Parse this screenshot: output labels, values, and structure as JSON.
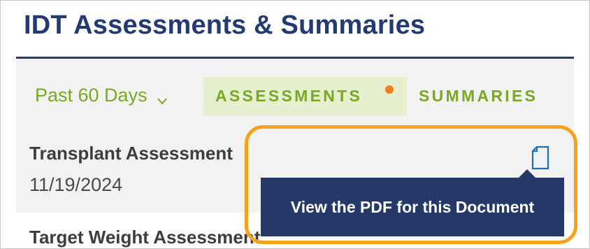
{
  "header": {
    "title": "IDT Assessments & Summaries"
  },
  "filters": {
    "range_label": "Past 60 Days",
    "range_icon": "chevron-down-icon"
  },
  "tabs": [
    {
      "label": "ASSESSMENTS",
      "selected": true,
      "has_notification": true
    },
    {
      "label": "SUMMARIES",
      "selected": false,
      "has_notification": false
    }
  ],
  "items": [
    {
      "title": "Transplant Assessment",
      "date": "11/19/2024",
      "action_icon": "document-icon"
    },
    {
      "title": "Target Weight Assessment"
    }
  ],
  "tooltip": {
    "text": "View the PDF for this Document"
  },
  "colors": {
    "brand_navy": "#243a73",
    "accent_green": "#79a924",
    "tab_selected_bg": "#e6f0cf",
    "notification_dot": "#ee7d1a",
    "highlight_ring": "#f5a31d",
    "tooltip_bg": "#253969",
    "icon_blue": "#1a6fb5"
  }
}
